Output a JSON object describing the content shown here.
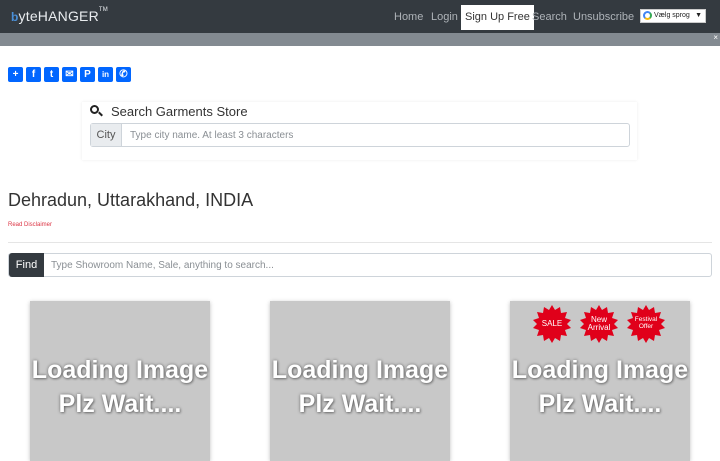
{
  "brand": {
    "mark": "b",
    "name": "yteHANGER",
    "tm": "TM"
  },
  "nav": {
    "home": "Home",
    "login": "Login",
    "signup": "Sign Up Free",
    "search": "Search",
    "unsubscribe": "Unsubscribe",
    "language": "Vælg sprog",
    "language_arrow": "▼"
  },
  "subbar": {
    "close": "×"
  },
  "share": {
    "buttons": [
      {
        "icon": "share-plus-icon",
        "glyph": "+"
      },
      {
        "icon": "facebook-icon",
        "glyph": "f"
      },
      {
        "icon": "twitter-icon",
        "glyph": "t"
      },
      {
        "icon": "email-icon",
        "glyph": "✉"
      },
      {
        "icon": "pinterest-icon",
        "glyph": "P"
      },
      {
        "icon": "linkedin-icon",
        "glyph": "in"
      },
      {
        "icon": "whatsapp-icon",
        "glyph": "✆"
      }
    ]
  },
  "search": {
    "title": "Search Garments Store",
    "city_label": "City",
    "city_placeholder": "Type city name. At least 3 characters",
    "city_value": ""
  },
  "location": {
    "title": "Dehradun, Uttarakhand, INDIA",
    "disclaimer": "Read Disclaimer"
  },
  "find": {
    "label": "Find",
    "placeholder": "Type Showroom Name, Sale, anything to search...",
    "value": ""
  },
  "cards": [
    {
      "line1": "Loading Image",
      "line2": "Plz Wait...."
    },
    {
      "line1": "Loading Image",
      "line2": "Plz Wait...."
    },
    {
      "line1": "Loading Image",
      "line2": "Plz Wait....",
      "badges": {
        "sale": "SALE",
        "new_line1": "New",
        "new_line2": "Arrival",
        "festival_line1": "Festival",
        "festival_line2": "Offer"
      }
    }
  ],
  "colors": {
    "navbar": "#343a40",
    "subbar": "#838a91",
    "share_blue": "#0166ff",
    "badge_red": "#e0001a",
    "disclaimer": "#dc3545",
    "card_placeholder": "#c8c8c8"
  }
}
